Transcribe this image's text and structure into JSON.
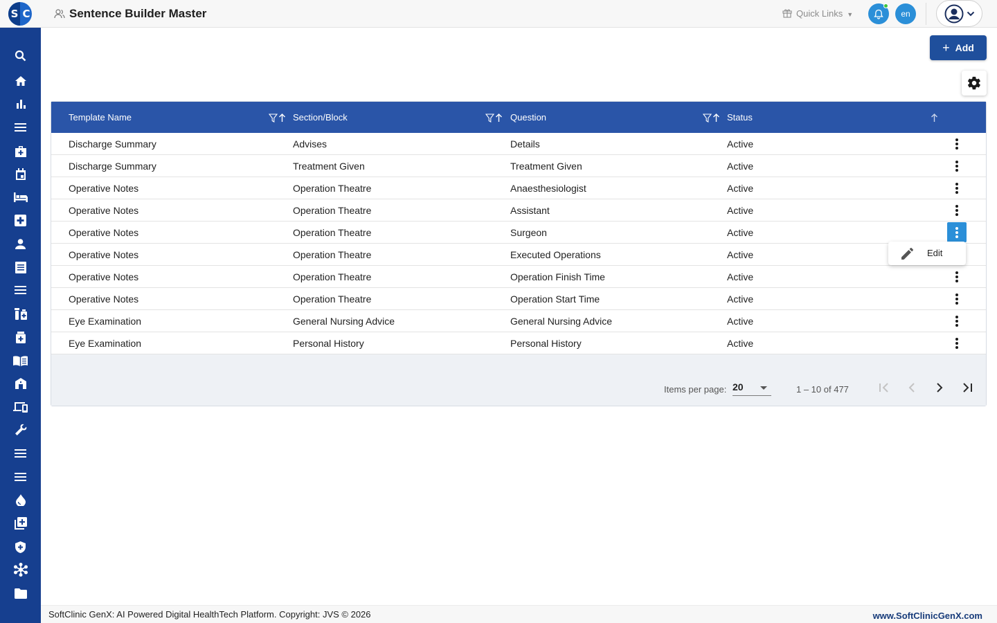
{
  "app": {
    "logo_left": "S",
    "logo_right": "C",
    "page_title": "Sentence Builder Master"
  },
  "header": {
    "quick_links_label": "Quick Links",
    "language": "en"
  },
  "sidebar": {
    "items": [
      {
        "icon": "search-icon"
      },
      {
        "icon": "home-icon"
      },
      {
        "icon": "bar-chart-icon"
      },
      {
        "icon": "menu-lines-icon"
      },
      {
        "icon": "medical-bag-icon"
      },
      {
        "icon": "calendar-icon"
      },
      {
        "icon": "bed-icon"
      },
      {
        "icon": "medical-plus-icon"
      },
      {
        "icon": "person-icon"
      },
      {
        "icon": "document-icon"
      },
      {
        "icon": "menu-lines-icon"
      },
      {
        "icon": "pharmacy-icon"
      },
      {
        "icon": "medicine-box-icon"
      },
      {
        "icon": "book-icon"
      },
      {
        "icon": "building-icon"
      },
      {
        "icon": "devices-icon"
      },
      {
        "icon": "wrench-icon"
      },
      {
        "icon": "menu-lines-icon"
      },
      {
        "icon": "menu-lines-icon"
      },
      {
        "icon": "blood-drop-icon"
      },
      {
        "icon": "add-library-icon"
      },
      {
        "icon": "shield-plus-icon"
      },
      {
        "icon": "network-icon"
      },
      {
        "icon": "folder-icon"
      }
    ]
  },
  "toolbar": {
    "add_label": "Add"
  },
  "table": {
    "columns": [
      "Template Name",
      "Section/Block",
      "Question",
      "Status"
    ],
    "rows": [
      [
        "Discharge Summary",
        "Advises",
        "Details",
        "Active"
      ],
      [
        "Discharge Summary",
        "Treatment Given",
        "Treatment Given",
        "Active"
      ],
      [
        "Operative Notes",
        "Operation Theatre",
        "Anaesthesiologist",
        "Active"
      ],
      [
        "Operative Notes",
        "Operation Theatre",
        "Assistant",
        "Active"
      ],
      [
        "Operative Notes",
        "Operation Theatre",
        "Surgeon",
        "Active"
      ],
      [
        "Operative Notes",
        "Operation Theatre",
        "Executed Operations",
        "Active"
      ],
      [
        "Operative Notes",
        "Operation Theatre",
        "Operation Finish Time",
        "Active"
      ],
      [
        "Operative Notes",
        "Operation Theatre",
        "Operation Start Time",
        "Active"
      ],
      [
        "Eye Examination",
        "General Nursing Advice",
        "General Nursing Advice",
        "Active"
      ],
      [
        "Eye Examination",
        "Personal History",
        "Personal History",
        "Active"
      ]
    ],
    "active_row_index": 4
  },
  "row_menu": {
    "edit_label": "Edit"
  },
  "pagination": {
    "items_per_page_label": "Items per page:",
    "items_per_page": "20",
    "range_label": "1 – 10 of 477"
  },
  "footer": {
    "copyright": "SoftClinic GenX: AI Powered Digital HealthTech Platform. Copyright: JVS © 2026",
    "site": "www.SoftClinicGenX.com"
  },
  "colors": {
    "sidebar": "#163f8f",
    "table_header": "#2a55a8",
    "primary_button": "#1f4f9c",
    "accent": "#2b8fd8"
  }
}
